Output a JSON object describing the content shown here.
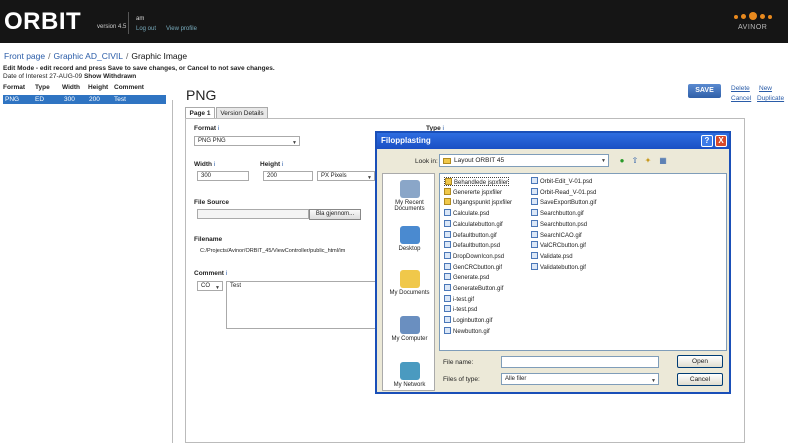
{
  "app": {
    "logo": "ORBIT",
    "version": "version 4.5",
    "user": "am",
    "logout": "Log out",
    "view_profile": "View profile",
    "brand": "AVINOR",
    "brand_color": "#e8891e"
  },
  "breadcrumb": {
    "items": [
      "Front page",
      "Graphic AD_CIVIL"
    ],
    "current": "Graphic Image"
  },
  "mode_text": "Edit Mode - edit record and press Save to save changes, or Cancel to not save changes.",
  "date_of_interest": {
    "label": "Date of Interest",
    "value": "27-AUG-09",
    "show_withdrawn": "Show Withdrawn"
  },
  "list": {
    "headers": [
      "Format",
      "Type",
      "Width",
      "Height",
      "Comment"
    ],
    "rows": [
      {
        "format": "PNG",
        "type": "ED",
        "width": "300",
        "height": "200",
        "comment": "Test"
      }
    ]
  },
  "record": {
    "title": "PNG",
    "save": "SAVE",
    "delete": "Delete",
    "new": "New",
    "cancel": "Cancel",
    "duplicate": "Duplicate",
    "tabs": [
      "Page 1",
      "Version Details"
    ]
  },
  "form": {
    "format_label": "Format",
    "format_value": "PNG PNG",
    "type_label": "Type",
    "width_label": "Width",
    "width_value": "300",
    "height_label": "Height",
    "height_value": "200",
    "unit_value": "PX Pixels",
    "file_source_label": "File Source",
    "browse_button": "Bla gjennom...",
    "filename_label": "Filename",
    "filename_value": "C:/Projects/Avinor/ORBIT_45/ViewController/public_html/im",
    "comment_label": "Comment",
    "comment_lang": "CO",
    "comment_value": "Test",
    "info_marker": "i"
  },
  "dialog": {
    "title": "Filopplasting",
    "look_in_label": "Look in:",
    "look_in_value": "Layout ORBIT 45",
    "places": [
      "My Recent Documents",
      "Desktop",
      "My Documents",
      "My Computer",
      "My Network"
    ],
    "files_col1": [
      {
        "name": "Behandlede jspxfiler",
        "kind": "folder"
      },
      {
        "name": "Genererte jspxfiler",
        "kind": "folder"
      },
      {
        "name": "Utgangspunkt jspxfiler",
        "kind": "folder"
      },
      {
        "name": "Calculate.psd",
        "kind": "doc"
      },
      {
        "name": "Calculatebutton.gif",
        "kind": "doc"
      },
      {
        "name": "Defaultbutton.gif",
        "kind": "doc"
      },
      {
        "name": "Defaultbutton.psd",
        "kind": "doc"
      },
      {
        "name": "DropDownIcon.psd",
        "kind": "doc"
      },
      {
        "name": "GenCRCbutton.gif",
        "kind": "doc"
      },
      {
        "name": "Generate.psd",
        "kind": "doc"
      },
      {
        "name": "GenerateButton.gif",
        "kind": "doc"
      },
      {
        "name": "i-test.gif",
        "kind": "doc"
      },
      {
        "name": "i-test.psd",
        "kind": "doc"
      },
      {
        "name": "Loginbutton.gif",
        "kind": "doc"
      },
      {
        "name": "Newbutton.gif",
        "kind": "doc"
      }
    ],
    "files_col2": [
      {
        "name": "Orbit-Edit_V-01.psd",
        "kind": "doc"
      },
      {
        "name": "Orbit-Read_V-01.psd",
        "kind": "doc"
      },
      {
        "name": "SaveExportButton.gif",
        "kind": "doc"
      },
      {
        "name": "Searchbutton.gif",
        "kind": "doc"
      },
      {
        "name": "Searchbutton.psd",
        "kind": "doc"
      },
      {
        "name": "SearchICAO.gif",
        "kind": "doc"
      },
      {
        "name": "ValCRCbutton.gif",
        "kind": "doc"
      },
      {
        "name": "Validate.psd",
        "kind": "doc"
      },
      {
        "name": "Validatebutton.gif",
        "kind": "doc"
      }
    ],
    "file_name_label": "File name:",
    "file_name_value": "",
    "files_of_type_label": "Files of type:",
    "files_of_type_value": "Alle filer",
    "open": "Open",
    "cancel": "Cancel",
    "help": "?",
    "close": "X"
  }
}
